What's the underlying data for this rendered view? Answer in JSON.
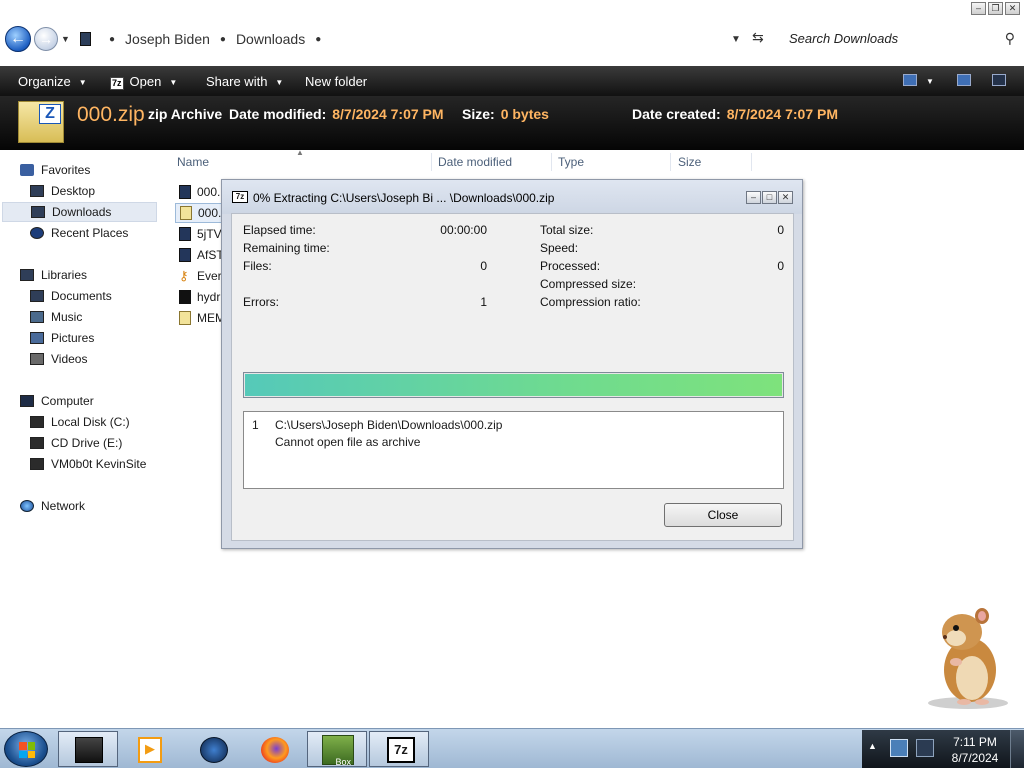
{
  "explorer": {
    "breadcrumb": [
      "Joseph Biden",
      "Downloads"
    ],
    "search_placeholder": "Search Downloads",
    "toolbar": {
      "organize": "Organize",
      "open": "Open",
      "share_with": "Share with",
      "new_folder": "New folder"
    },
    "details": {
      "name": "000.zip",
      "type": "zip Archive",
      "date_modified_label": "Date modified:",
      "date_modified": "8/7/2024 7:07 PM",
      "size_label": "Size:",
      "size": "0 bytes",
      "date_created_label": "Date created:",
      "date_created": "8/7/2024 7:07 PM"
    },
    "nav": {
      "favorites": "Favorites",
      "desktop": "Desktop",
      "downloads": "Downloads",
      "recent_places": "Recent Places",
      "libraries": "Libraries",
      "documents": "Documents",
      "music": "Music",
      "pictures": "Pictures",
      "videos": "Videos",
      "computer": "Computer",
      "local_disk": "Local Disk (C:)",
      "cd_drive": "CD Drive (E:)",
      "network_share": "VM0b0t KevinSite",
      "network": "Network"
    },
    "columns": {
      "name": "Name",
      "date_modified": "Date modified",
      "type": "Type",
      "size": "Size"
    },
    "files": [
      {
        "name": "000.1",
        "icon": "app-icon"
      },
      {
        "name": "000.zip",
        "icon": "zip-icon"
      },
      {
        "name": "5jTV",
        "icon": "app-icon"
      },
      {
        "name": "AfST",
        "icon": "app-icon"
      },
      {
        "name": "Ever",
        "icon": "key-icon"
      },
      {
        "name": "hydr",
        "icon": "dark-app-icon"
      },
      {
        "name": "MEM",
        "icon": "zip-icon"
      }
    ]
  },
  "dialog": {
    "title": "0% Extracting C:\\Users\\Joseph Bi ... \\Downloads\\000.zip",
    "app_icon_text": "7z",
    "labels": {
      "elapsed": "Elapsed time:",
      "remaining": "Remaining time:",
      "files": "Files:",
      "errors": "Errors:",
      "total_size": "Total size:",
      "speed": "Speed:",
      "processed": "Processed:",
      "compressed_size": "Compressed size:",
      "compression_ratio": "Compression ratio:"
    },
    "values": {
      "elapsed": "00:00:00",
      "files": "0",
      "errors": "1",
      "total_size": "0",
      "processed": "0"
    },
    "progress_fraction": 1.0,
    "log": {
      "number": "1",
      "path": "C:\\Users\\Joseph Biden\\Downloads\\000.zip",
      "message": "Cannot open file as archive"
    },
    "close_label": "Close"
  },
  "taskbar": {
    "time": "7:11 PM",
    "date": "8/7/2024",
    "box_label": "Box",
    "sevenzip_label": "7z"
  },
  "colors": {
    "detail_accent": "#ffb562",
    "progress_start": "#55c9b9",
    "progress_end": "#7ee27c"
  }
}
